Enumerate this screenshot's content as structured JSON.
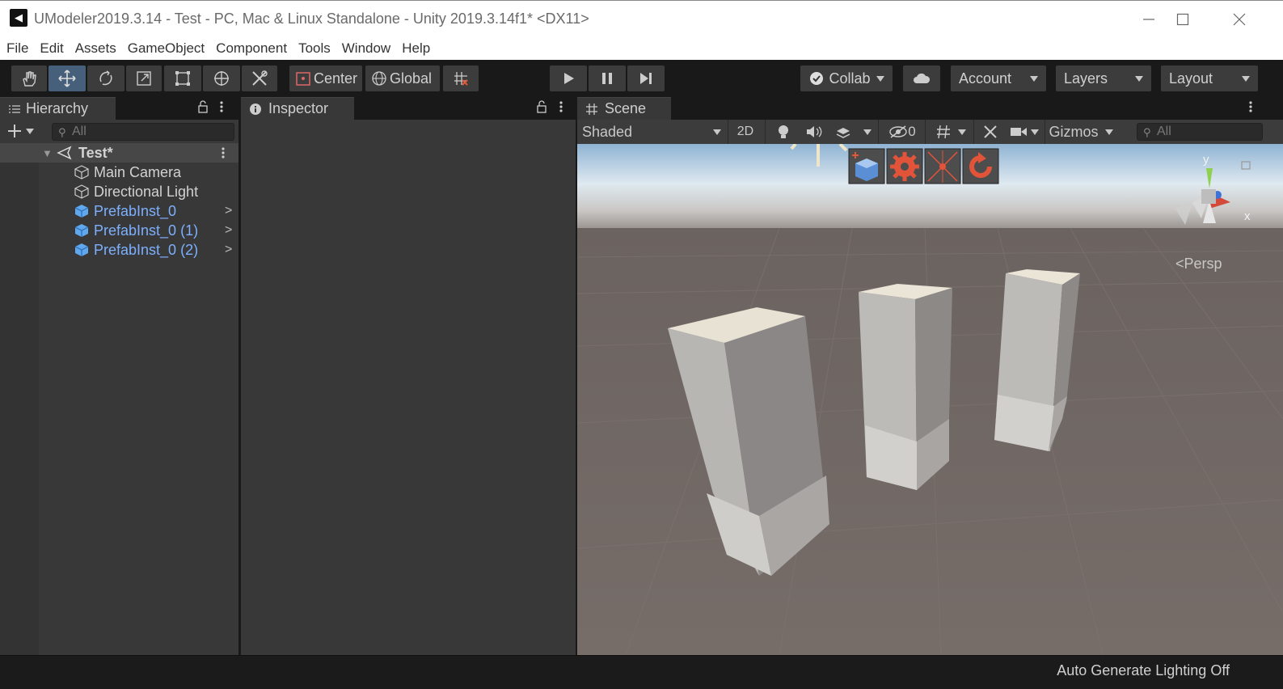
{
  "window": {
    "title": "UModeler2019.3.14 - Test - PC, Mac & Linux Standalone - Unity 2019.3.14f1* <DX11>"
  },
  "menu": [
    "File",
    "Edit",
    "Assets",
    "GameObject",
    "Component",
    "Tools",
    "Window",
    "Help"
  ],
  "toolbar": {
    "pivot": "Center",
    "space": "Global",
    "collab": "Collab",
    "account": "Account",
    "layers": "Layers",
    "layout": "Layout"
  },
  "hierarchy": {
    "tab": "Hierarchy",
    "search_placeholder": "All",
    "scene": "Test*",
    "items": [
      {
        "label": "Main Camera",
        "prefab": false
      },
      {
        "label": "Directional Light",
        "prefab": false
      },
      {
        "label": "PrefabInst_0",
        "prefab": true
      },
      {
        "label": "PrefabInst_0 (1)",
        "prefab": true
      },
      {
        "label": "PrefabInst_0 (2)",
        "prefab": true
      }
    ]
  },
  "inspector": {
    "tab": "Inspector"
  },
  "scene": {
    "tab": "Scene",
    "shading": "Shaded",
    "mode2d": "2D",
    "hidden_count": "0",
    "gizmos": "Gizmos",
    "search_placeholder": "All",
    "gizmo_y": "y",
    "gizmo_x": "x",
    "projection": "Persp"
  },
  "status": {
    "message": "Auto Generate Lighting Off"
  },
  "colors": {
    "accent_blue": "#46607c",
    "prefab_text": "#7cb0ff",
    "panel": "#383838",
    "toolbar": "#191919"
  }
}
